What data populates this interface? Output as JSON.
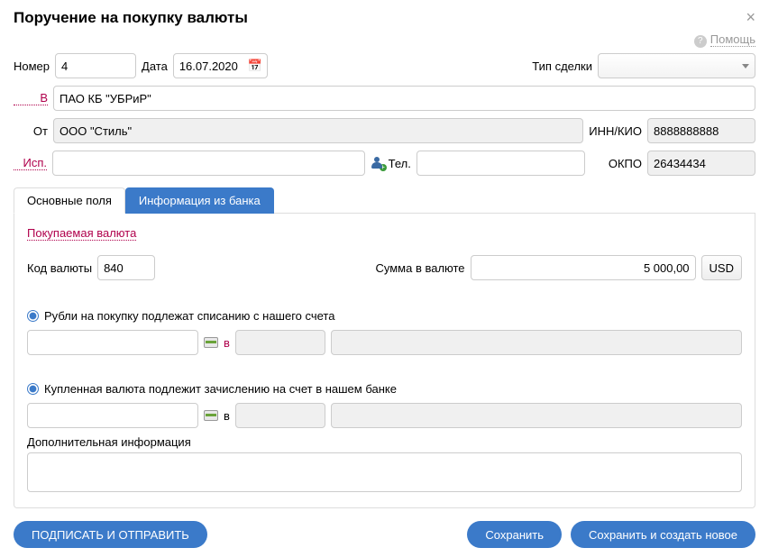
{
  "title": "Поручение на покупку валюты",
  "help_label": "Помощь",
  "labels": {
    "number": "Номер",
    "date": "Дата",
    "deal_type": "Тип сделки",
    "to_bank": "В",
    "from": "От",
    "inn_kio": "ИНН/КИО",
    "isp": "Исп.",
    "tel": "Тел.",
    "okpo": "ОКПО",
    "v_short": "в"
  },
  "header": {
    "number": "4",
    "date": "16.07.2020",
    "deal_type": ""
  },
  "bank_to": "ПАО КБ \"УБРиР\"",
  "from": "ООО \"Стиль\"",
  "inn_kio": "8888888888",
  "isp": "",
  "tel": "",
  "okpo": "26434434",
  "tabs": {
    "main": "Основные поля",
    "bank_info": "Информация из банка"
  },
  "currency": {
    "section": "Покупаемая валюта",
    "code_label": "Код валюты",
    "code": "840",
    "amount_label": "Сумма в валюте",
    "amount": "5 000,00",
    "ccy": "USD"
  },
  "radios": {
    "rub_from_account": "Рубли на покупку подлежат списанию с нашего счета",
    "credit_to_account": "Купленная валюта подлежит зачислению на счет в нашем банке"
  },
  "extra_info_label": "Дополнительная информация",
  "buttons": {
    "sign_send": "ПОДПИСАТЬ И ОТПРАВИТЬ",
    "save": "Сохранить",
    "save_create": "Сохранить и создать новое"
  }
}
